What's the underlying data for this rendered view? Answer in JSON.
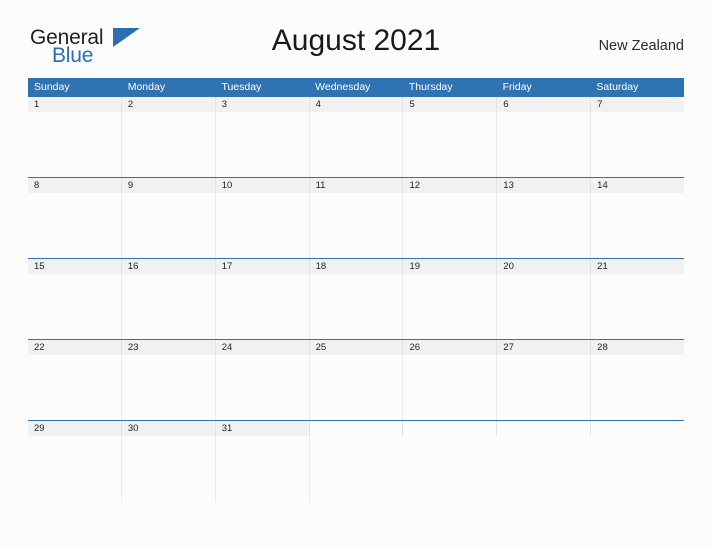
{
  "brand": {
    "name_part1": "General",
    "name_part2": "Blue",
    "triangle_icon": "blue-triangle-icon",
    "primary_color": "#2b6fb0"
  },
  "header": {
    "title": "August 2021",
    "region": "New Zealand"
  },
  "calendar": {
    "month": "August",
    "year": "2021",
    "accent_color": "#2f73b3",
    "date_band_color": "#f1f1f1",
    "weekday_headers": [
      "Sunday",
      "Monday",
      "Tuesday",
      "Wednesday",
      "Thursday",
      "Friday",
      "Saturday"
    ],
    "weeks": [
      [
        "1",
        "2",
        "3",
        "4",
        "5",
        "6",
        "7"
      ],
      [
        "8",
        "9",
        "10",
        "11",
        "12",
        "13",
        "14"
      ],
      [
        "15",
        "16",
        "17",
        "18",
        "19",
        "20",
        "21"
      ],
      [
        "22",
        "23",
        "24",
        "25",
        "26",
        "27",
        "28"
      ],
      [
        "29",
        "30",
        "31",
        "",
        "",
        "",
        ""
      ]
    ]
  }
}
